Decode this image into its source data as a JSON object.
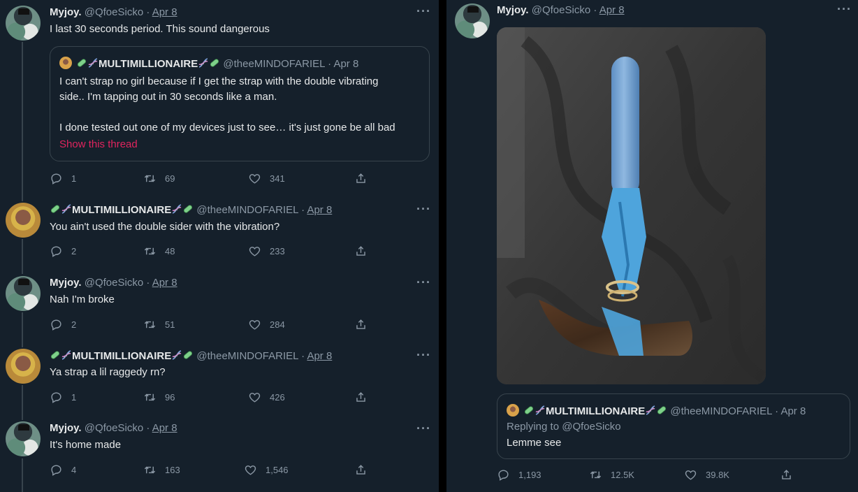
{
  "left": {
    "tweets": [
      {
        "name": "Myjoy.",
        "handle": "@QfoeSicko",
        "date": "Apr 8",
        "text": "I last 30 seconds period. This sound dangerous",
        "quote": {
          "name": "MULTIMILLIONAIRE",
          "handle": "@theeMINDOFARIEL",
          "date": "Apr 8",
          "lines": [
            "I can't strap no girl because if I get the strap with the double vibrating",
            "side.. I'm tapping out in 30 seconds like a man.",
            "I done tested out one of my devices just to see… it's just gone be all bad"
          ],
          "show_thread": "Show this thread"
        },
        "replies": "1",
        "retweets": "69",
        "likes": "341"
      },
      {
        "name": "MULTIMILLIONAIRE",
        "handle": "@theeMINDOFARIEL",
        "date": "Apr 8",
        "text": "You ain't used the double sider with the vibration?",
        "replies": "2",
        "retweets": "48",
        "likes": "233"
      },
      {
        "name": "Myjoy.",
        "handle": "@QfoeSicko",
        "date": "Apr 8",
        "text": "Nah I'm broke",
        "replies": "2",
        "retweets": "51",
        "likes": "284"
      },
      {
        "name": "MULTIMILLIONAIRE",
        "handle": "@theeMINDOFARIEL",
        "date": "Apr 8",
        "text": "Ya strap a lil raggedy rn?",
        "replies": "1",
        "retweets": "96",
        "likes": "426"
      },
      {
        "name": "Myjoy.",
        "handle": "@QfoeSicko",
        "date": "Apr 8",
        "text": "It's home made",
        "replies": "4",
        "retweets": "163",
        "likes": "1,546"
      }
    ]
  },
  "right": {
    "tweet": {
      "name": "Myjoy.",
      "handle": "@QfoeSicko",
      "date": "Apr 8",
      "quote": {
        "name": "MULTIMILLIONAIRE",
        "handle": "@theeMINDOFARIEL",
        "date": "Apr 8",
        "replying_to": "Replying to @QfoeSicko",
        "text": "Lemme see"
      },
      "replies": "1,193",
      "retweets": "12.5K",
      "likes": "39.8K"
    }
  },
  "icons": {
    "reply": "reply-icon",
    "retweet": "retweet-icon",
    "like": "heart-icon",
    "share": "share-icon",
    "more": "more-icon",
    "pill": "pill-emoji",
    "dna": "dna-emoji"
  },
  "colors": {
    "background": "#15202b",
    "muted": "#8b98a5",
    "link": "#e0245e",
    "border": "#38444d"
  }
}
